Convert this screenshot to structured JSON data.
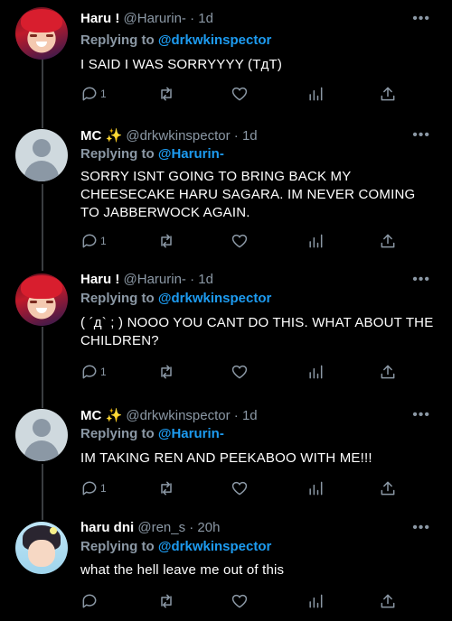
{
  "tweets": [
    {
      "name": "Haru !",
      "handle": "@Harurin-",
      "time": "· 1d",
      "replying_label": "Replying to",
      "replying_to": "@drkwkinspector",
      "text": "I SAID I WAS SORRYYYY (ТдТ)",
      "reply_count": "1",
      "avatar": "haru-avatar"
    },
    {
      "name": "MC ✨",
      "handle": "@drkwkinspector",
      "time": "· 1d",
      "replying_label": "Replying to",
      "replying_to": "@Harurin-",
      "text": "SORRY ISNT GOING TO BRING BACK MY CHEESECAKE HARU SAGARA. IM NEVER COMING TO JABBERWOCK AGAIN.",
      "reply_count": "1",
      "avatar": "default-avatar"
    },
    {
      "name": "Haru !",
      "handle": "@Harurin-",
      "time": "· 1d",
      "replying_label": "Replying to",
      "replying_to": "@drkwkinspector",
      "text": "( ´д` ; ) NOOO YOU CANT DO THIS. WHAT ABOUT THE CHILDREN?",
      "reply_count": "1",
      "avatar": "haru-avatar"
    },
    {
      "name": "MC ✨",
      "handle": "@drkwkinspector",
      "time": "· 1d",
      "replying_label": "Replying to",
      "replying_to": "@Harurin-",
      "text": "IM TAKING REN AND PEEKABOO WITH ME!!!",
      "reply_count": "1",
      "avatar": "default-avatar"
    },
    {
      "name": "haru dni",
      "handle": "@ren_s",
      "time": "· 20h",
      "replying_label": "Replying to",
      "replying_to": "@drkwkinspector",
      "text": "what the hell leave me out of this",
      "reply_count": "",
      "avatar": "ren-avatar"
    }
  ],
  "more_glyph": "•••",
  "colors": {
    "background": "#000000",
    "mention": "#1d9bf0",
    "muted": "#8b98a5",
    "text": "#ffffff"
  }
}
